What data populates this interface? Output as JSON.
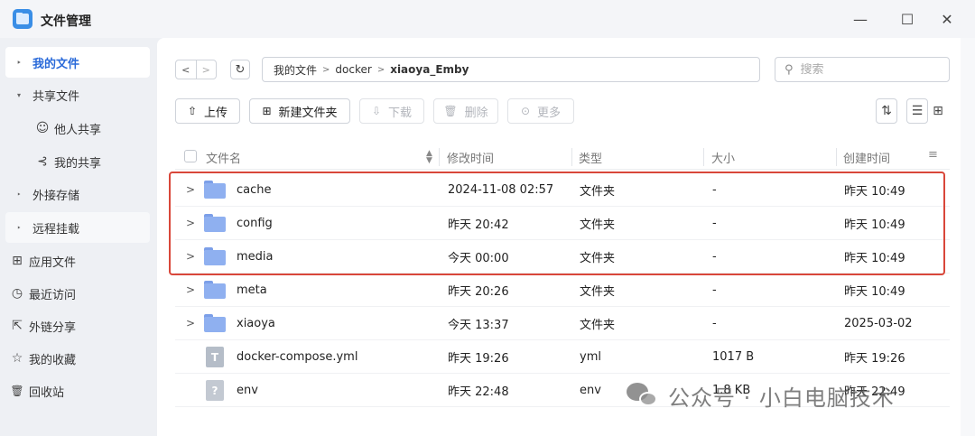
{
  "window": {
    "title": "文件管理",
    "controls": {
      "minimize": "—",
      "maximize": "☐",
      "close": "✕"
    }
  },
  "sidebar": {
    "items": [
      {
        "label": "我的文件",
        "marker": "‣",
        "active": true
      },
      {
        "label": "共享文件",
        "marker": "▾",
        "active": false
      },
      {
        "label": "他人共享",
        "icon": "people-icon",
        "glyph": "☺",
        "sub": true
      },
      {
        "label": "我的共享",
        "icon": "share-icon",
        "glyph": "⊰",
        "sub": true
      },
      {
        "label": "外接存储",
        "marker": "‣"
      },
      {
        "label": "远程挂载",
        "marker": "‣"
      },
      {
        "label": "应用文件",
        "icon": "apps-icon",
        "glyph": "⊞"
      },
      {
        "label": "最近访问",
        "icon": "clock-icon",
        "glyph": "◷"
      },
      {
        "label": "外链分享",
        "icon": "external-share-icon",
        "glyph": "⇱"
      },
      {
        "label": "我的收藏",
        "icon": "star-icon",
        "glyph": "☆"
      },
      {
        "label": "回收站",
        "icon": "trash-icon",
        "glyph": "🗑"
      }
    ]
  },
  "nav": {
    "back": "<",
    "forward": ">",
    "refresh": "↻",
    "breadcrumb": [
      "我的文件",
      "docker",
      "xiaoya_Emby"
    ],
    "search_placeholder": "搜索"
  },
  "toolbar": {
    "upload": "上传",
    "new_folder": "新建文件夹",
    "download": "下载",
    "delete": "删除",
    "more": "更多"
  },
  "table": {
    "headers": {
      "name": "文件名",
      "modified": "修改时间",
      "type": "类型",
      "size": "大小",
      "created": "创建时间"
    },
    "rows": [
      {
        "name": "cache",
        "kind": "folder",
        "modified": "2024-11-08 02:57",
        "type": "文件夹",
        "size": "-",
        "created": "昨天 10:49"
      },
      {
        "name": "config",
        "kind": "folder",
        "modified": "昨天 20:42",
        "type": "文件夹",
        "size": "-",
        "created": "昨天 10:49"
      },
      {
        "name": "media",
        "kind": "folder",
        "modified": "今天 00:00",
        "type": "文件夹",
        "size": "-",
        "created": "昨天 10:49"
      },
      {
        "name": "meta",
        "kind": "folder",
        "modified": "昨天 20:26",
        "type": "文件夹",
        "size": "-",
        "created": "昨天 10:49"
      },
      {
        "name": "xiaoya",
        "kind": "folder",
        "modified": "今天 13:37",
        "type": "文件夹",
        "size": "-",
        "created": "2025-03-02"
      },
      {
        "name": "docker-compose.yml",
        "kind": "text-file",
        "icon_glyph": "T",
        "modified": "昨天 19:26",
        "type": "yml",
        "size": "1017 B",
        "created": "昨天 19:26"
      },
      {
        "name": "env",
        "kind": "unknown-file",
        "icon_glyph": "?",
        "modified": "昨天 22:48",
        "type": "env",
        "size": "1.8 KB",
        "created": "昨天 22:49"
      }
    ]
  },
  "highlight_color": "#d9473a",
  "watermark": "公众号 · 小白电脑技术"
}
